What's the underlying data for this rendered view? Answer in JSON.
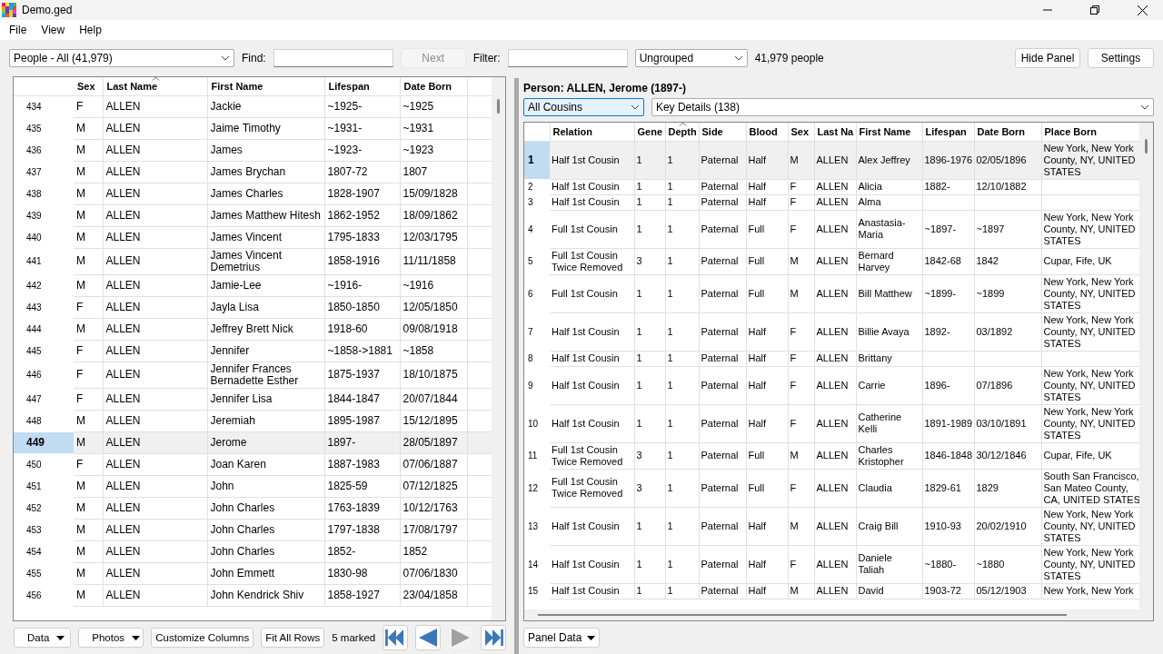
{
  "window": {
    "title": "Demo.ged"
  },
  "menu": [
    "File",
    "View",
    "Help"
  ],
  "toolbar": {
    "view_select": "People - All (41,979)",
    "find_label": "Find:",
    "next_button": {
      "label": "Next",
      "disabled": true
    },
    "filter_label": "Filter:",
    "group_select": "Ungrouped",
    "count": "41,979 people",
    "buttons": [
      "Hide Panel",
      "Settings"
    ]
  },
  "people_table": {
    "columns": [
      {
        "label": "Sex",
        "sorted": false
      },
      {
        "label": "Last Name",
        "sorted": true
      },
      {
        "label": "First Name",
        "sorted": false
      },
      {
        "label": "Lifespan",
        "sorted": false
      },
      {
        "label": "Date Born",
        "sorted": false
      }
    ],
    "rows": [
      {
        "num": "434",
        "cells": [
          "F",
          "ALLEN",
          "Jackie",
          "~1925-",
          "~1925"
        ],
        "selected": false
      },
      {
        "num": "435",
        "cells": [
          "M",
          "ALLEN",
          "Jaime Timothy",
          "~1931-",
          "~1931"
        ],
        "selected": false
      },
      {
        "num": "436",
        "cells": [
          "M",
          "ALLEN",
          "James",
          "~1923-",
          "~1923"
        ],
        "selected": false
      },
      {
        "num": "437",
        "cells": [
          "M",
          "ALLEN",
          "James Brychan",
          "1807-72",
          "1807"
        ],
        "selected": false
      },
      {
        "num": "438",
        "cells": [
          "M",
          "ALLEN",
          "James Charles",
          "1828-1907",
          "15/09/1828"
        ],
        "selected": false
      },
      {
        "num": "439",
        "cells": [
          "M",
          "ALLEN",
          "James Matthew Hitesh",
          "1862-1952",
          "18/09/1862"
        ],
        "selected": false
      },
      {
        "num": "440",
        "cells": [
          "M",
          "ALLEN",
          "James Vincent",
          "1795-1833",
          "12/03/1795"
        ],
        "selected": false
      },
      {
        "num": "441",
        "cells": [
          "M",
          "ALLEN",
          "James Vincent Demetrius",
          "1858-1916",
          "11/11/1858"
        ],
        "selected": false
      },
      {
        "num": "442",
        "cells": [
          "M",
          "ALLEN",
          "Jamie-Lee",
          "~1916-",
          "~1916"
        ],
        "selected": false
      },
      {
        "num": "443",
        "cells": [
          "F",
          "ALLEN",
          "Jayla Lisa",
          "1850-1850",
          "12/05/1850"
        ],
        "selected": false
      },
      {
        "num": "444",
        "cells": [
          "M",
          "ALLEN",
          "Jeffrey Brett Nick",
          "1918-60",
          "09/08/1918"
        ],
        "selected": false
      },
      {
        "num": "445",
        "cells": [
          "F",
          "ALLEN",
          "Jennifer",
          "~1858->1881",
          "~1858"
        ],
        "selected": false
      },
      {
        "num": "446",
        "cells": [
          "F",
          "ALLEN",
          "Jennifer Frances Bernadette Esther",
          "1875-1937",
          "18/10/1875"
        ],
        "selected": false
      },
      {
        "num": "447",
        "cells": [
          "F",
          "ALLEN",
          "Jennifer Lisa",
          "1844-1847",
          "20/07/1844"
        ],
        "selected": false
      },
      {
        "num": "448",
        "cells": [
          "M",
          "ALLEN",
          "Jeremiah",
          "1895-1987",
          "15/12/1895"
        ],
        "selected": false
      },
      {
        "num": "449",
        "cells": [
          "M",
          "ALLEN",
          "Jerome",
          "1897-",
          "28/05/1897"
        ],
        "selected": true
      },
      {
        "num": "450",
        "cells": [
          "F",
          "ALLEN",
          "Joan Karen",
          "1887-1983",
          "07/06/1887"
        ],
        "selected": false
      },
      {
        "num": "451",
        "cells": [
          "M",
          "ALLEN",
          "John",
          "1825-59",
          "07/12/1825"
        ],
        "selected": false
      },
      {
        "num": "452",
        "cells": [
          "M",
          "ALLEN",
          "John Charles",
          "1763-1839",
          "10/12/1763"
        ],
        "selected": false
      },
      {
        "num": "453",
        "cells": [
          "M",
          "ALLEN",
          "John Charles",
          "1797-1838",
          "17/08/1797"
        ],
        "selected": false
      },
      {
        "num": "454",
        "cells": [
          "M",
          "ALLEN",
          "John Charles",
          "1852-",
          "1852"
        ],
        "selected": false
      },
      {
        "num": "455",
        "cells": [
          "M",
          "ALLEN",
          "John Emmett",
          "1830-98",
          "07/06/1830"
        ],
        "selected": false
      },
      {
        "num": "456",
        "cells": [
          "M",
          "ALLEN",
          "John Kendrick Shiv",
          "1858-1927",
          "23/04/1858"
        ],
        "selected": false
      }
    ]
  },
  "bottom_bar": {
    "menus": [
      "Data",
      "Photos"
    ],
    "buttons": [
      "Customize Columns",
      "Fit All Rows"
    ],
    "marked": "5 marked",
    "nav": [
      {
        "kind": "first",
        "disabled": false
      },
      {
        "kind": "previous",
        "disabled": false
      },
      {
        "kind": "next",
        "disabled": true
      },
      {
        "kind": "last",
        "disabled": false
      }
    ]
  },
  "panel": {
    "title": "Person: ALLEN, Jerome (1897-)",
    "relation_select": "All Cousins",
    "details_select": "Key Details (138)",
    "columns": [
      {
        "label": "Relation",
        "sorted": false
      },
      {
        "label": "Gene",
        "sorted": false
      },
      {
        "label": "Depth",
        "sorted": true
      },
      {
        "label": "Side",
        "sorted": false
      },
      {
        "label": "Blood",
        "sorted": false
      },
      {
        "label": "Sex",
        "sorted": false
      },
      {
        "label": "Last Na",
        "sorted": false
      },
      {
        "label": "First Name",
        "sorted": false
      },
      {
        "label": "Lifespan",
        "sorted": false
      },
      {
        "label": "Date Born",
        "sorted": false
      },
      {
        "label": "Place Born",
        "sorted": false
      }
    ],
    "rows": [
      {
        "num": "1",
        "cells": [
          "Half 1st Cousin",
          "1",
          "1",
          "Paternal",
          "Half",
          "M",
          "ALLEN",
          "Alex Jeffrey",
          "1896-1976",
          "02/05/1896",
          "New York, New York County, NY, UNITED STATES"
        ],
        "selected": true
      },
      {
        "num": "2",
        "cells": [
          "Half 1st Cousin",
          "1",
          "1",
          "Paternal",
          "Half",
          "F",
          "ALLEN",
          "Alicia",
          "1882-",
          "12/10/1882",
          ""
        ],
        "selected": false
      },
      {
        "num": "3",
        "cells": [
          "Half 1st Cousin",
          "1",
          "1",
          "Paternal",
          "Half",
          "F",
          "ALLEN",
          "Alma",
          "",
          "",
          ""
        ],
        "selected": false
      },
      {
        "num": "4",
        "cells": [
          "Full 1st Cousin",
          "1",
          "1",
          "Paternal",
          "Full",
          "F",
          "ALLEN",
          "Anastasia-Maria",
          "~1897-",
          "~1897",
          "New York, New York County, NY, UNITED STATES"
        ],
        "selected": false
      },
      {
        "num": "5",
        "cells": [
          "Full 1st Cousin Twice Removed",
          "3",
          "1",
          "Paternal",
          "Full",
          "M",
          "ALLEN",
          "Bernard Harvey",
          "1842-68",
          "1842",
          "Cupar, Fife, UK"
        ],
        "selected": false
      },
      {
        "num": "6",
        "cells": [
          "Full 1st Cousin",
          "1",
          "1",
          "Paternal",
          "Full",
          "M",
          "ALLEN",
          "Bill Matthew",
          "~1899-",
          "~1899",
          "New York, New York County, NY, UNITED STATES"
        ],
        "selected": false
      },
      {
        "num": "7",
        "cells": [
          "Half 1st Cousin",
          "1",
          "1",
          "Paternal",
          "Half",
          "F",
          "ALLEN",
          "Billie Avaya",
          "1892-",
          "03/1892",
          "New York, New York County, NY, UNITED STATES"
        ],
        "selected": false
      },
      {
        "num": "8",
        "cells": [
          "Half 1st Cousin",
          "1",
          "1",
          "Paternal",
          "Half",
          "F",
          "ALLEN",
          "Brittany",
          "",
          "",
          ""
        ],
        "selected": false
      },
      {
        "num": "9",
        "cells": [
          "Half 1st Cousin",
          "1",
          "1",
          "Paternal",
          "Half",
          "F",
          "ALLEN",
          "Carrie",
          "1896-",
          "07/1896",
          "New York, New York County, NY, UNITED STATES"
        ],
        "selected": false
      },
      {
        "num": "10",
        "cells": [
          "Half 1st Cousin",
          "1",
          "1",
          "Paternal",
          "Half",
          "F",
          "ALLEN",
          "Catherine Kelli",
          "1891-1989",
          "03/10/1891",
          "New York, New York County, NY, UNITED STATES"
        ],
        "selected": false
      },
      {
        "num": "11",
        "cells": [
          "Full 1st Cousin Twice Removed",
          "3",
          "1",
          "Paternal",
          "Full",
          "M",
          "ALLEN",
          "Charles Kristopher",
          "1846-1848",
          "30/12/1846",
          "Cupar, Fife, UK"
        ],
        "selected": false
      },
      {
        "num": "12",
        "cells": [
          "Full 1st Cousin Twice Removed",
          "3",
          "1",
          "Paternal",
          "Full",
          "F",
          "ALLEN",
          "Claudia",
          "1829-61",
          "1829",
          "South San Francisco, San Mateo County, CA, UNITED STATES"
        ],
        "selected": false
      },
      {
        "num": "13",
        "cells": [
          "Half 1st Cousin",
          "1",
          "1",
          "Paternal",
          "Half",
          "M",
          "ALLEN",
          "Craig Bill",
          "1910-93",
          "20/02/1910",
          "New York, New York County, NY, UNITED STATES"
        ],
        "selected": false
      },
      {
        "num": "14",
        "cells": [
          "Half 1st Cousin",
          "1",
          "1",
          "Paternal",
          "Half",
          "F",
          "ALLEN",
          "Daniele Taliah",
          "~1880-",
          "~1880",
          "New York, New York County, NY, UNITED STATES"
        ],
        "selected": false
      },
      {
        "num": "15",
        "cells": [
          "Half 1st Cousin",
          "1",
          "1",
          "Paternal",
          "Half",
          "M",
          "ALLEN",
          "David",
          "1903-72",
          "05/12/1903",
          "New York, New York"
        ],
        "selected": false
      }
    ],
    "menu": "Panel Data"
  }
}
